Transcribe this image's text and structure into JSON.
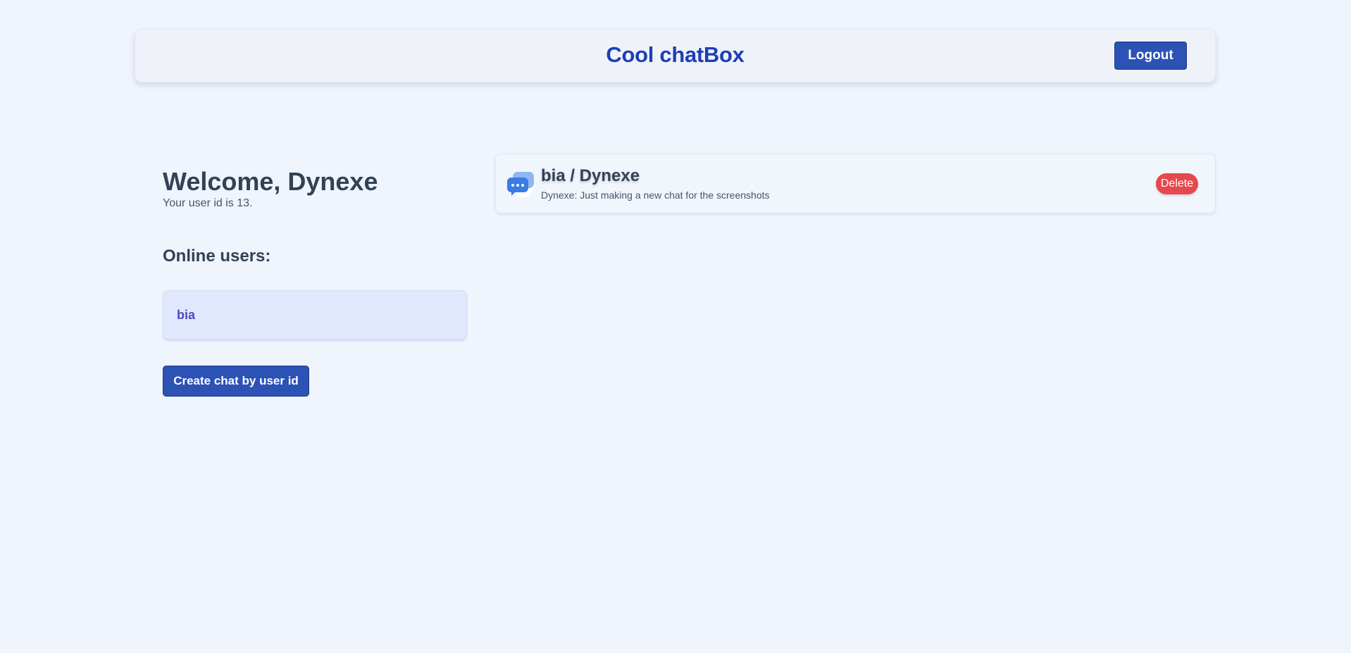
{
  "header": {
    "title": "Cool chatBox",
    "logout_label": "Logout"
  },
  "sidebar": {
    "welcome": "Welcome, Dynexe",
    "user_id_text": "Your user id is 13.",
    "online_title": "Online users:",
    "online_users": [
      "bia"
    ],
    "create_chat_label": "Create chat by user id"
  },
  "chats": [
    {
      "icon": "chat-bubbles-icon",
      "title": "bia / Dynexe",
      "preview": "Dynexe: Just making a new chat for the screenshots",
      "delete_label": "Delete"
    }
  ],
  "colors": {
    "background": "#eff4fd",
    "primary_button": "#2c52b5",
    "title": "#1d3fb5",
    "delete": "#e5484d",
    "online_user_bg": "#e1e7fd",
    "online_user_text": "#4f46c8"
  }
}
